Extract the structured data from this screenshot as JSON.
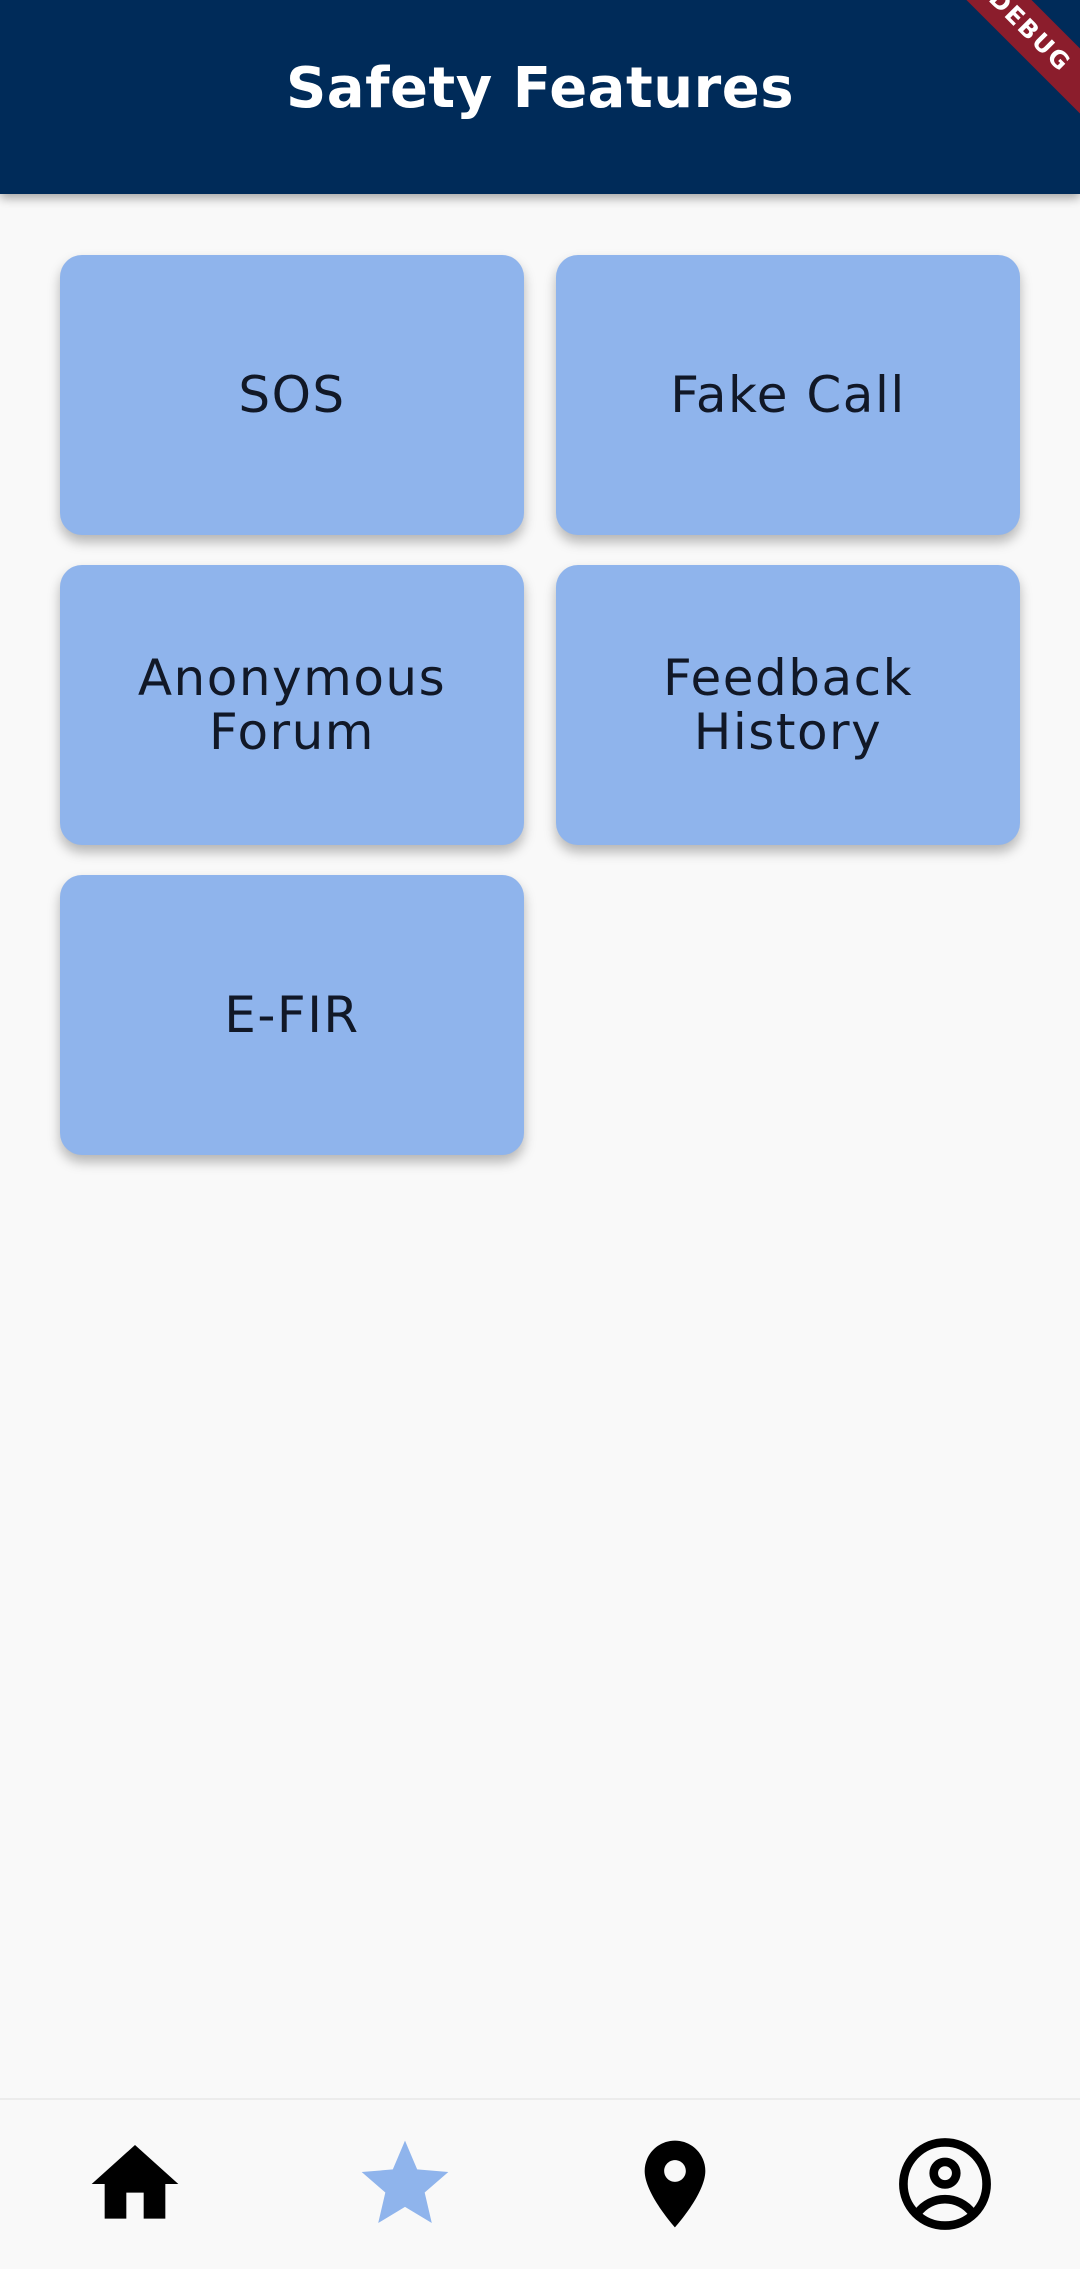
{
  "app_bar": {
    "title": "Safety Features",
    "background": "#002b59",
    "debug_banner": "DEBUG"
  },
  "features": [
    {
      "label": "SOS"
    },
    {
      "label": "Fake Call"
    },
    {
      "label": "Anonymous Forum"
    },
    {
      "label": "Feedback History"
    },
    {
      "label": "E-FIR"
    }
  ],
  "card_color": "#8fb4ec",
  "bottom_nav": {
    "items": [
      {
        "icon": "home-icon",
        "selected": false,
        "color": "#000000"
      },
      {
        "icon": "star-icon",
        "selected": true,
        "color": "#8fb4ec"
      },
      {
        "icon": "location-pin-icon",
        "selected": false,
        "color": "#000000"
      },
      {
        "icon": "account-circle-icon",
        "selected": false,
        "color": "#000000"
      }
    ]
  }
}
